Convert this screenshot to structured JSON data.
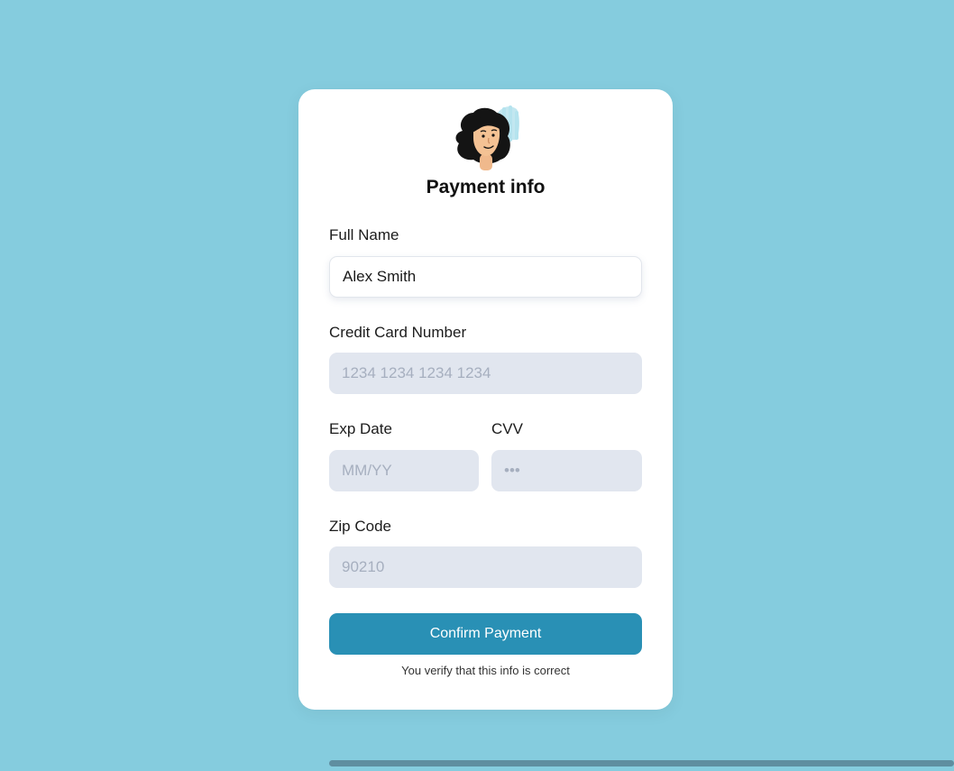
{
  "page": {
    "background_color": "#85ccde",
    "accent_color": "#2990b5"
  },
  "card": {
    "avatar_icon": "woman-avatar",
    "title": "Payment info",
    "full_name": {
      "label": "Full Name",
      "value": "Alex Smith"
    },
    "card_number": {
      "label": "Credit Card Number",
      "placeholder": "1234 1234 1234 1234"
    },
    "exp_date": {
      "label": "Exp Date",
      "placeholder": "MM/YY"
    },
    "cvv": {
      "label": "CVV",
      "placeholder": "•••"
    },
    "zip_code": {
      "label": "Zip Code",
      "placeholder": "90210"
    },
    "confirm_button": "Confirm Payment",
    "note": "You verify that this info is correct"
  }
}
